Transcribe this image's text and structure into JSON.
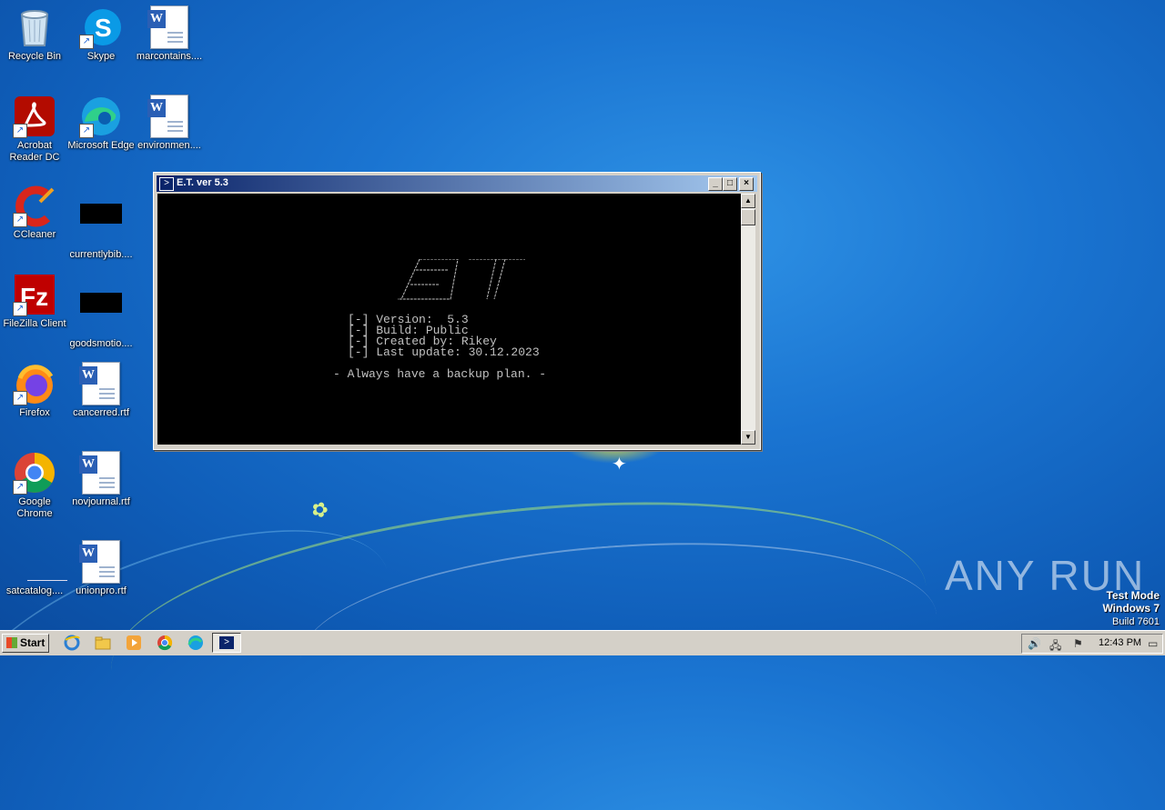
{
  "desktop": {
    "icons": [
      {
        "label": "Recycle Bin",
        "icon": "recycle-bin-icon"
      },
      {
        "label": "Skype",
        "icon": "skype-icon"
      },
      {
        "label": "marcontains....",
        "icon": "word-doc-icon"
      },
      {
        "label": "Acrobat Reader DC",
        "icon": "acrobat-icon"
      },
      {
        "label": "Microsoft Edge",
        "icon": "edge-icon"
      },
      {
        "label": "environmen....",
        "icon": "word-doc-icon"
      },
      {
        "label": "CCleaner",
        "icon": "ccleaner-icon"
      },
      {
        "label": "currentlybib....",
        "icon": "black-file-icon"
      },
      {
        "label": "FileZilla Client",
        "icon": "filezilla-icon"
      },
      {
        "label": "goodsmotio....",
        "icon": "black-file-icon"
      },
      {
        "label": "Firefox",
        "icon": "firefox-icon"
      },
      {
        "label": "cancerred.rtf",
        "icon": "word-doc-icon"
      },
      {
        "label": "Google Chrome",
        "icon": "chrome-icon"
      },
      {
        "label": "novjournal.rtf",
        "icon": "word-doc-icon"
      },
      {
        "label": "satcatalog....",
        "icon": "blank-file-icon"
      },
      {
        "label": "unionpro.rtf",
        "icon": "word-doc-icon"
      }
    ]
  },
  "console_window": {
    "title": "E.T. ver 5.3",
    "lines": [
      "[-] Version:  5.3",
      "[-] Build: Public",
      "[-] Created by: Rikey",
      "[-] Last update: 30.12.2023"
    ],
    "motto": "- Always have a backup plan. -"
  },
  "watermark": {
    "brand": "ANY RUN",
    "test_mode": "Test Mode",
    "os": "Windows 7",
    "build": "Build 7601"
  },
  "taskbar": {
    "start_label": "Start",
    "quick_launch": [
      "ie-icon",
      "explorer-icon",
      "media-player-icon",
      "chrome-icon",
      "edge-icon"
    ],
    "clock": "12:43 PM"
  }
}
